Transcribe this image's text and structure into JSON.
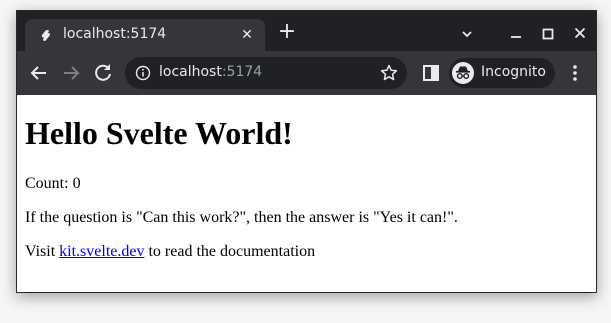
{
  "browser": {
    "tab": {
      "title": "localhost:5174",
      "close_icon": "close-icon",
      "favicon": "svelte-favicon"
    },
    "new_tab_label": "+",
    "window_controls": {
      "dropdown": "tab-search-chevron-icon",
      "minimize": "minimize-icon",
      "maximize": "maximize-icon",
      "close": "close-window-icon"
    },
    "omnibox": {
      "host": "localhost",
      "port": ":5174"
    },
    "incognito_label": "Incognito",
    "colors": {
      "frame": "#202124",
      "toolbar": "#35363a",
      "text": "#e8eaed",
      "dim_text": "#9aa0a6"
    }
  },
  "page": {
    "heading": "Hello Svelte World!",
    "count_label": "Count: 0",
    "question_text": "If the question is \"Can this work?\", then the answer is \"Yes it can!\".",
    "visit_prefix": "Visit ",
    "link_text": "kit.svelte.dev",
    "visit_suffix": " to read the documentation",
    "link_color": "#0000ee"
  }
}
